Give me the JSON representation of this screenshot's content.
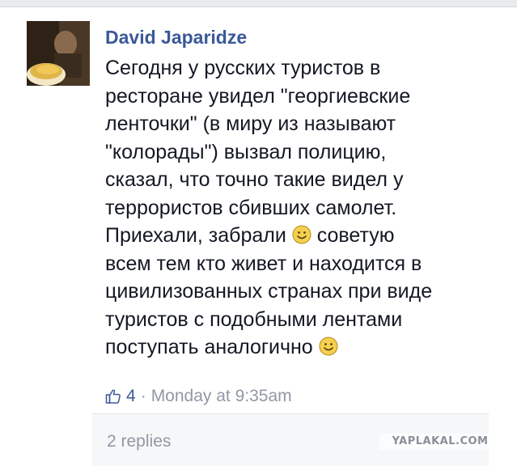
{
  "comment": {
    "author": "David Japaridze",
    "lines": [
      "Сегодня у русских туристов в",
      "ресторане увидел \"георгиевские",
      "ленточки\" (в миру из называют",
      "\"колорады\") вызвал полицию,",
      "сказал, что точно такие видел у",
      "террористов сбивших самолет.",
      "Приехали, забрали",
      "советую",
      "всем тем кто живет и находится в",
      "цивилизованных странах при виде",
      "туристов с подобными лентами",
      "поступать аналогично"
    ],
    "like_count": "4",
    "separator": "·",
    "timestamp": "Monday at 9:35am",
    "replies_label": "2 replies"
  },
  "icons": {
    "like": "thumbs-up-icon",
    "emoticon": "smiley-icon"
  },
  "watermark": "YAPLAKAL.COM",
  "colors": {
    "author": "#3b5998",
    "text": "#141823",
    "meta": "#9197a3",
    "smiley": "#f5d04e"
  }
}
